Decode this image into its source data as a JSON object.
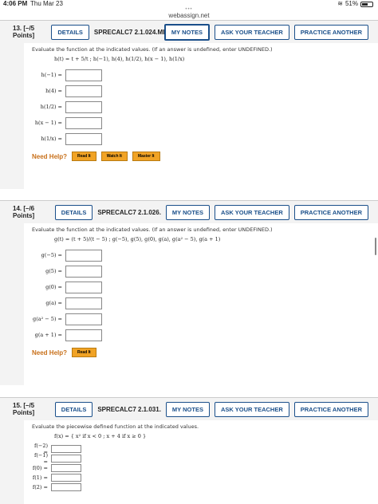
{
  "status": {
    "time": "4:06 PM",
    "date": "Thu Mar 23",
    "battery": "51%"
  },
  "browser": {
    "url": "webassign.net"
  },
  "buttons": {
    "details": "DETAILS",
    "my_notes": "MY NOTES",
    "ask_teacher": "ASK YOUR TEACHER",
    "practice": "PRACTICE ANOTHER"
  },
  "q13": {
    "number": "13. [–/5 Points]",
    "code": "SPRECALC7 2.1.024.MI.",
    "instruction": "Evaluate the function at the indicated values. (If an answer is undefined, enter UNDEFINED.)",
    "function": "h(t) = t + 5/t ;   h(−1), h(4), h(1/2), h(x − 1), h(1/x)",
    "rows": [
      "h(−1) =",
      "h(4) =",
      "h(1/2) =",
      "h(x − 1) =",
      "h(1/x) ="
    ],
    "help_title": "Need Help?",
    "help_buttons": [
      "Read It",
      "Watch It",
      "Master It"
    ]
  },
  "q14": {
    "number": "14. [–/6 Points]",
    "code": "SPRECALC7 2.1.026.",
    "instruction": "Evaluate the function at the indicated values. (If an answer is undefined, enter UNDEFINED.)",
    "function": "g(t) = (t + 5)/(t − 5) ;   g(−5), g(5), g(0), g(a), g(a² − 5), g(a + 1)",
    "rows": [
      "g(−5) =",
      "g(5) =",
      "g(0) =",
      "g(a) =",
      "g(a² − 5) =",
      "g(a + 1) ="
    ],
    "help_title": "Need Help?",
    "help_buttons": [
      "Read It"
    ]
  },
  "q15": {
    "number": "15. [–/5 Points]",
    "code": "SPRECALC7 2.1.031.",
    "instruction": "Evaluate the piecewise defined function at the indicated values.",
    "function": "f(x) = { x²  if x < 0 ;  x + 4  if x ≥ 0 }",
    "rows": [
      "f(−2) =",
      "f(−1) =",
      "f(0) =",
      "f(1) =",
      "f(2) ="
    ]
  }
}
